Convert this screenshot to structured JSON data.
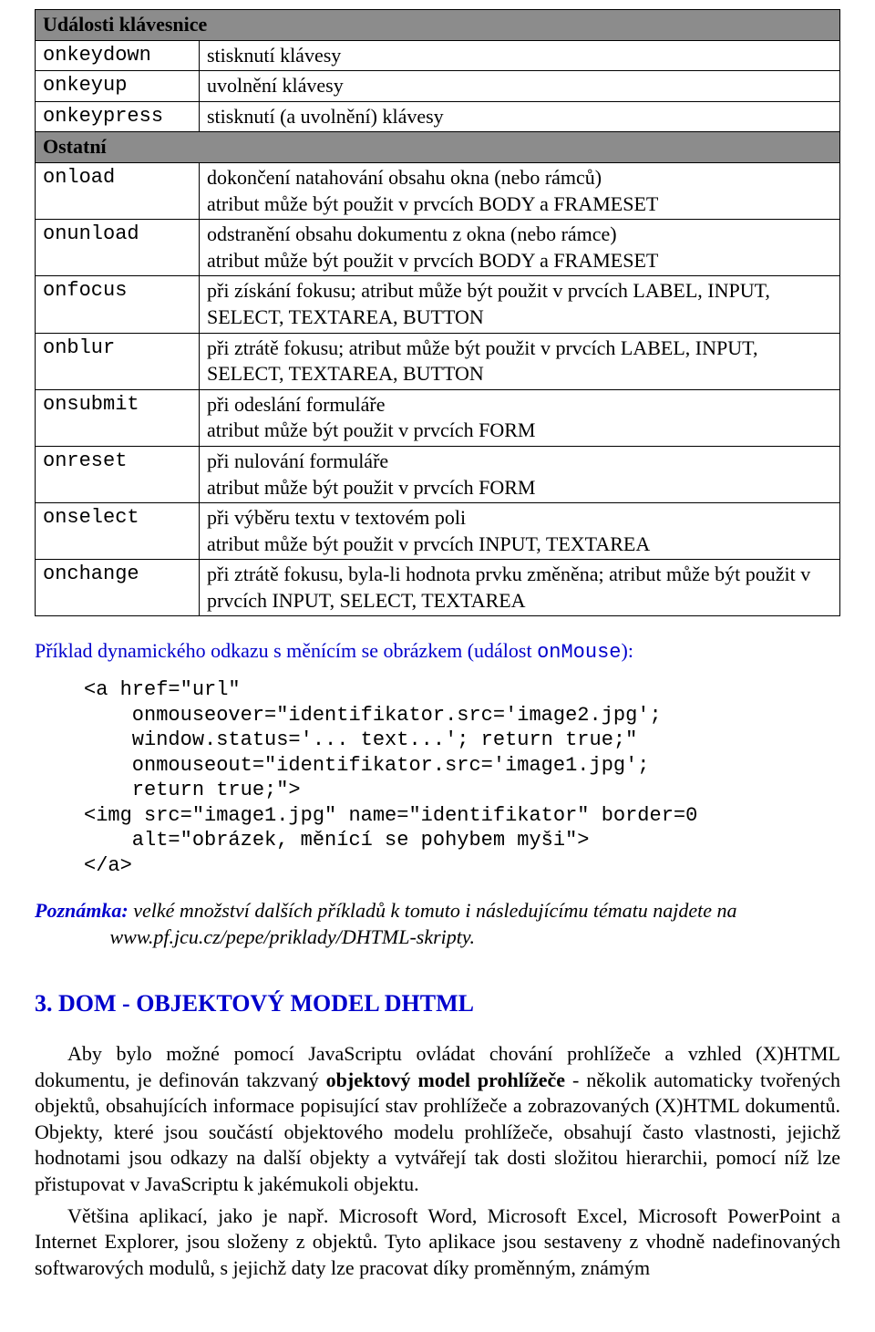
{
  "table": {
    "section_keyboard": "Události klávesnice",
    "rows1": [
      {
        "k": "onkeydown",
        "v": "stisknutí klávesy"
      },
      {
        "k": "onkeyup",
        "v": "uvolnění klávesy"
      },
      {
        "k": "onkeypress",
        "v": "stisknutí (a uvolnění) klávesy"
      }
    ],
    "section_other": "Ostatní",
    "rows2": [
      {
        "k": "onload",
        "v": "dokončení natahování obsahu okna (nebo rámců)\natribut může být použit v prvcích BODY a FRAMESET"
      },
      {
        "k": "onunload",
        "v": "odstranění obsahu dokumentu z okna (nebo rámce)\natribut může být použit v prvcích BODY a FRAMESET"
      },
      {
        "k": "onfocus",
        "v": "při získání fokusu; atribut může být použit v prvcích LABEL, INPUT, SELECT, TEXTAREA, BUTTON"
      },
      {
        "k": "onblur",
        "v": "při ztrátě fokusu; atribut může být použit v prvcích LABEL, INPUT, SELECT, TEXTAREA, BUTTON"
      },
      {
        "k": "onsubmit",
        "v": "při odeslání formuláře\natribut může být použit v prvcích FORM"
      },
      {
        "k": "onreset",
        "v": "při nulování formuláře\natribut může být použit v prvcích FORM"
      },
      {
        "k": "onselect",
        "v": "při výběru textu v textovém poli\natribut může být použit v prvcích INPUT, TEXTAREA"
      },
      {
        "k": "onchange",
        "v": "při ztrátě fokusu, byla-li hodnota prvku změněna; atribut může být použit v prvcích INPUT, SELECT, TEXTAREA"
      }
    ]
  },
  "intro_prefix": "Příklad dynamického odkazu s měnícím se obrázkem (událost ",
  "intro_mono": "onMouse",
  "intro_suffix": "):",
  "code": "<a href=\"url\"\n    onmouseover=\"identifikator.src='image2.jpg';\n    window.status='... text...'; return true;\"\n    onmouseout=\"identifikator.src='image1.jpg';\n    return true;\">\n<img src=\"image1.jpg\" name=\"identifikator\" border=0\n    alt=\"obrázek, měnící se pohybem myši\">\n</a>",
  "note_label": "Poznámka:",
  "note_text": " velké množství dalších příkladů k tomuto i následujícímu tématu najdete na\n               www.pf.jcu.cz/pepe/priklady/DHTML-skripty.",
  "heading": "3. DOM - OBJEKTOVÝ MODEL DHTML",
  "para1_prefix": "Aby bylo možné pomocí JavaScriptu ovládat chování prohlížeče a vzhled (X)HTML dokumentu, je definován takzvaný ",
  "para1_bold": "objektový model prohlížeče",
  "para1_suffix": " - několik automaticky tvořených objektů, obsahujících informace popisující stav prohlížeče a zobrazovaných (X)HTML dokumentů. Objekty, které jsou součástí objektového modelu prohlížeče, obsahují často vlastnosti, jejichž hodnotami jsou odkazy na další objekty a vytvářejí tak dosti složitou hierarchii, pomocí níž lze přistupovat v JavaScriptu k jakémukoli objektu.",
  "para2": "Většina aplikací, jako je např. Microsoft Word, Microsoft Excel, Microsoft PowerPoint a Internet Explorer, jsou složeny z objektů. Tyto aplikace jsou sestaveny z vhodně nadefinovaných softwarových modulů, s jejichž daty lze pracovat díky proměnným, známým"
}
